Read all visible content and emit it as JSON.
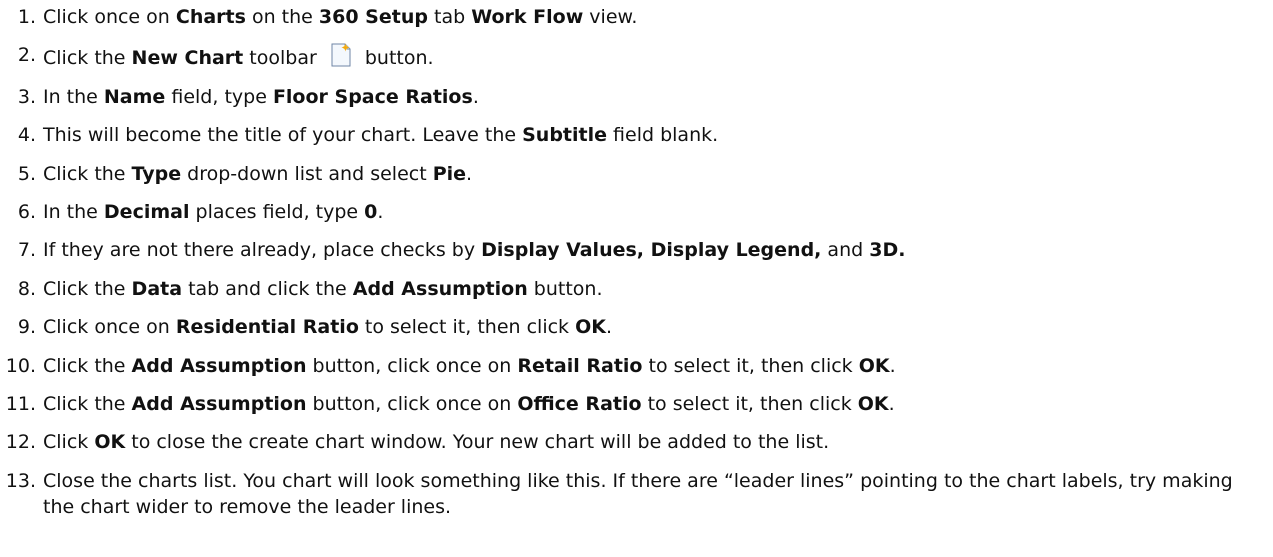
{
  "steps": [
    {
      "number": "1",
      "segments": [
        {
          "t": "Click once on "
        },
        {
          "t": "Charts",
          "b": true
        },
        {
          "t": " on the "
        },
        {
          "t": "360 Setup",
          "b": true
        },
        {
          "t": " tab "
        },
        {
          "t": "Work Flow",
          "b": true
        },
        {
          "t": " view."
        }
      ]
    },
    {
      "number": "2",
      "segments": [
        {
          "t": "Click the "
        },
        {
          "t": "New Chart",
          "b": true
        },
        {
          "t": " toolbar "
        },
        {
          "icon": "new-chart-icon"
        },
        {
          "t": " button."
        }
      ]
    },
    {
      "number": "3",
      "segments": [
        {
          "t": "In the "
        },
        {
          "t": "Name",
          "b": true
        },
        {
          "t": " field, type "
        },
        {
          "t": "Floor Space Ratios",
          "b": true
        },
        {
          "t": "."
        }
      ]
    },
    {
      "number": "4",
      "segments": [
        {
          "t": "This will become the title of your chart. Leave the "
        },
        {
          "t": "Subtitle",
          "b": true
        },
        {
          "t": " field blank."
        }
      ]
    },
    {
      "number": "5",
      "segments": [
        {
          "t": "Click the "
        },
        {
          "t": "Type",
          "b": true
        },
        {
          "t": " drop-down list and select "
        },
        {
          "t": "Pie",
          "b": true
        },
        {
          "t": "."
        }
      ]
    },
    {
      "number": "6",
      "segments": [
        {
          "t": "In the "
        },
        {
          "t": "Decimal",
          "b": true
        },
        {
          "t": " places field, type "
        },
        {
          "t": "0",
          "b": true
        },
        {
          "t": "."
        }
      ]
    },
    {
      "number": "7",
      "segments": [
        {
          "t": "If they are not there already, place checks by "
        },
        {
          "t": "Display Values, Display Legend,",
          "b": true
        },
        {
          "t": " and "
        },
        {
          "t": "3D.",
          "b": true
        }
      ]
    },
    {
      "number": "8",
      "segments": [
        {
          "t": "Click the "
        },
        {
          "t": "Data",
          "b": true
        },
        {
          "t": " tab and click the "
        },
        {
          "t": "Add Assumption",
          "b": true
        },
        {
          "t": " button."
        }
      ]
    },
    {
      "number": "9",
      "segments": [
        {
          "t": "Click once on "
        },
        {
          "t": "Residential Ratio",
          "b": true
        },
        {
          "t": " to select it, then click "
        },
        {
          "t": "OK",
          "b": true
        },
        {
          "t": "."
        }
      ]
    },
    {
      "number": "10",
      "segments": [
        {
          "t": "Click the "
        },
        {
          "t": "Add Assumption",
          "b": true
        },
        {
          "t": " button, click once on "
        },
        {
          "t": "Retail Ratio",
          "b": true
        },
        {
          "t": " to select it, then click "
        },
        {
          "t": "OK",
          "b": true
        },
        {
          "t": "."
        }
      ]
    },
    {
      "number": "11",
      "segments": [
        {
          "t": "Click the "
        },
        {
          "t": "Add Assumption",
          "b": true
        },
        {
          "t": " button, click once on "
        },
        {
          "t": "Office Ratio",
          "b": true
        },
        {
          "t": " to select it, then click "
        },
        {
          "t": "OK",
          "b": true
        },
        {
          "t": "."
        }
      ]
    },
    {
      "number": "12",
      "segments": [
        {
          "t": "Click "
        },
        {
          "t": "OK",
          "b": true
        },
        {
          "t": " to close the create chart window. Your new chart will be added to the list."
        }
      ]
    },
    {
      "number": "13",
      "segments": [
        {
          "t": "Close the charts list.  You chart will look something like this.  If there are “leader lines” pointing to the chart labels, try making the chart wider to remove the leader lines."
        }
      ]
    }
  ]
}
